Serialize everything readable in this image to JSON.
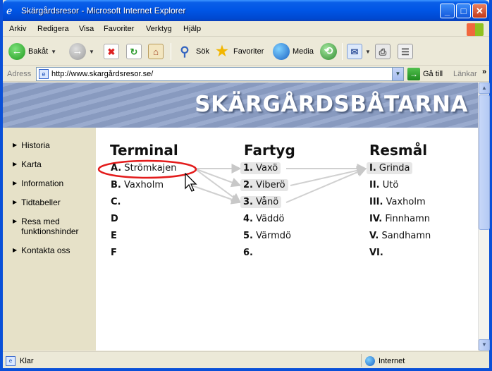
{
  "window": {
    "title": "Skärgårdsresor - Microsoft Internet Explorer",
    "buttons": {
      "minimize": "_",
      "maximize": "□",
      "close": "✕"
    }
  },
  "menu": [
    "Arkiv",
    "Redigera",
    "Visa",
    "Favoriter",
    "Verktyg",
    "Hjälp"
  ],
  "toolbar": {
    "back_label": "Bakåt",
    "search_label": "Sök",
    "favorites_label": "Favoriter",
    "media_label": "Media"
  },
  "address": {
    "label": "Adress",
    "url": "http://www.skargårdsresor.se/",
    "go_label": "Gå till",
    "links_label": "Länkar"
  },
  "page": {
    "banner_title": "SKÄRGÅRDSBÅTARNA",
    "nav": [
      "Historia",
      "Karta",
      "Information",
      "Tidtabeller",
      "Resa med funktionshinder",
      "Kontakta oss"
    ],
    "columns": {
      "terminal": {
        "heading": "Terminal",
        "rows": [
          {
            "key": "A.",
            "name": "Strömkajen"
          },
          {
            "key": "B.",
            "name": "Vaxholm"
          },
          {
            "key": "C.",
            "name": ""
          },
          {
            "key": "D",
            "name": ""
          },
          {
            "key": "E",
            "name": ""
          },
          {
            "key": "F",
            "name": ""
          }
        ]
      },
      "fartyg": {
        "heading": "Fartyg",
        "rows": [
          {
            "key": "1.",
            "name": "Vaxö"
          },
          {
            "key": "2.",
            "name": "Viberö"
          },
          {
            "key": "3.",
            "name": "Vånö"
          },
          {
            "key": "4.",
            "name": "Väddö"
          },
          {
            "key": "5.",
            "name": "Värmdö"
          },
          {
            "key": "6.",
            "name": ""
          }
        ]
      },
      "resmal": {
        "heading": "Resmål",
        "rows": [
          {
            "key": "I.",
            "name": "Grinda"
          },
          {
            "key": "II.",
            "name": "Utö"
          },
          {
            "key": "III.",
            "name": "Vaxholm"
          },
          {
            "key": "IV.",
            "name": "Finnhamn"
          },
          {
            "key": "V.",
            "name": "Sandhamn"
          },
          {
            "key": "VI.",
            "name": ""
          }
        ]
      }
    },
    "highlight_color": "#e31b1b"
  },
  "status": {
    "text": "Klar",
    "zone": "Internet"
  }
}
